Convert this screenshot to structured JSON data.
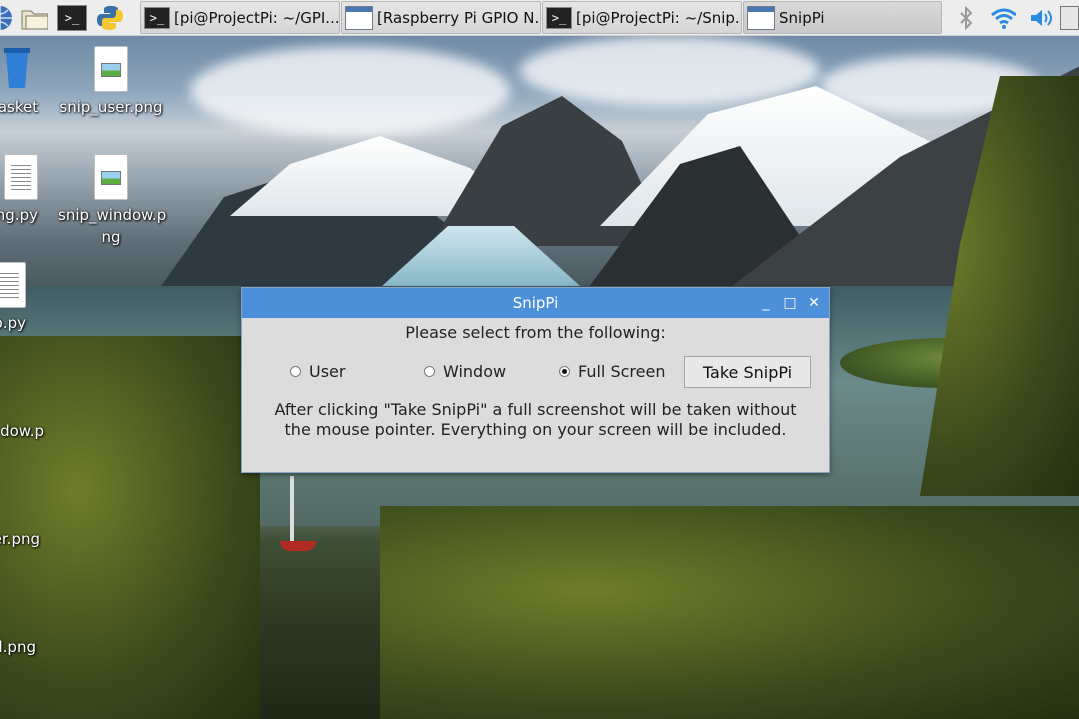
{
  "taskbar": {
    "launchers": [
      {
        "icon": "globe-icon"
      },
      {
        "icon": "folder-icon"
      },
      {
        "icon": "terminal-icon",
        "glyph": ">_"
      },
      {
        "icon": "python-icon"
      }
    ],
    "tasks": [
      {
        "label": "[pi@ProjectPi: ~/GPI...",
        "icon": "terminal-icon",
        "glyph": ">_",
        "active": false
      },
      {
        "label": "[Raspberry Pi GPIO N...",
        "icon": "window-icon",
        "active": false
      },
      {
        "label": "[pi@ProjectPi: ~/Snip...",
        "icon": "terminal-icon",
        "glyph": ">_",
        "active": false
      },
      {
        "label": "SnipPi",
        "icon": "window-icon",
        "active": true
      }
    ],
    "tray": [
      "bluetooth-icon",
      "wifi-icon",
      "volume-icon",
      "cpu-monitor-icon"
    ]
  },
  "desktop": {
    "icons": [
      {
        "label": "asket",
        "icon": "trash-icon"
      },
      {
        "label": "snip_user.png",
        "icon": "image-file-icon"
      },
      {
        "label": "ng.py",
        "icon": "python-file-icon"
      },
      {
        "label": "snip_window.p",
        "label2": "ng",
        "icon": "image-file-icon"
      },
      {
        "label": "p.py",
        "icon": "python-file-icon"
      },
      {
        "label": "dow.p",
        "icon": "image-file-icon"
      },
      {
        "label": "er.png",
        "icon": "image-file-icon"
      },
      {
        "label": "l.png",
        "icon": "image-file-icon"
      }
    ]
  },
  "dialog": {
    "title": "SnipPi",
    "controls": {
      "minimize": "_",
      "maximize": "□",
      "close": "✕"
    },
    "prompt": "Please select from the following:",
    "options": [
      {
        "label": "User",
        "checked": false
      },
      {
        "label": "Window",
        "checked": false
      },
      {
        "label": "Full Screen",
        "checked": true
      }
    ],
    "action_label": "Take SnipPi",
    "description_line1": "After clicking \"Take SnipPi\" a full screenshot will be taken without",
    "description_line2": "the mouse pointer. Everything on your screen will be included.",
    "accent_color": "#4d8fd8"
  }
}
